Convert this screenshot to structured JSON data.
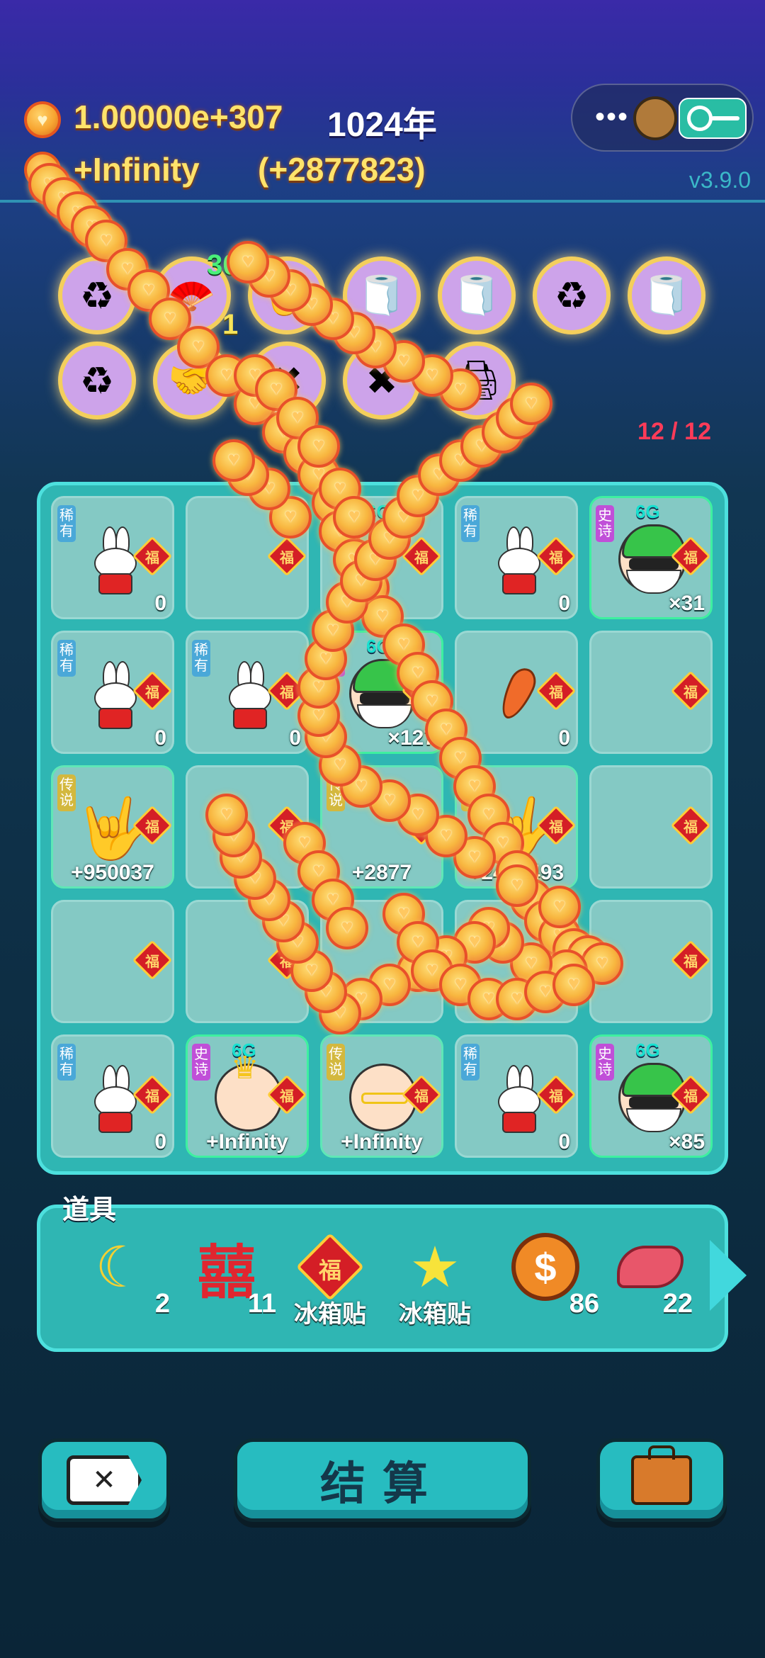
{
  "header": {
    "coins": "1.00000e+307",
    "year": "1024年",
    "rate": "+Infinity",
    "rate_detail": "(+2877823)",
    "version": "v3.9.0",
    "menu_icon": "more-dots-icon",
    "close_icon": "close-circle-icon"
  },
  "skills": {
    "row1": [
      {
        "icon": "recycle-icon",
        "count": ""
      },
      {
        "icon": "fan-icon",
        "count": "30"
      },
      {
        "icon": "rock-hand-icon",
        "count": ""
      },
      {
        "icon": "tissue-box-icon",
        "count": ""
      },
      {
        "icon": "tissue-box-icon",
        "count": ""
      },
      {
        "icon": "recycle-icon",
        "count": ""
      },
      {
        "icon": "tissue-box-icon",
        "count": ""
      }
    ],
    "row2": [
      {
        "icon": "recycle-icon",
        "count": ""
      },
      {
        "icon": "handshake-icon",
        "count": "1"
      },
      {
        "icon": "multiplier-icon",
        "count": ""
      },
      {
        "icon": "multiplier-icon",
        "count": ""
      },
      {
        "icon": "printer-icon",
        "count": ""
      }
    ],
    "row2_extra_count": "1",
    "slots": "12 / 12"
  },
  "board": {
    "cells": [
      {
        "tag": "稀有",
        "char": "rabbit",
        "count": "0"
      },
      {
        "tag": "",
        "char": "",
        "count": ""
      },
      {
        "tag": "",
        "char": "",
        "count": "",
        "lvl": "6G"
      },
      {
        "tag": "稀有",
        "char": "rabbit",
        "count": "0"
      },
      {
        "tag": "史诗",
        "char": "green-hat",
        "count": "×31",
        "lvl": "6G"
      },
      {
        "tag": "稀有",
        "char": "rabbit",
        "count": "0"
      },
      {
        "tag": "稀有",
        "char": "rabbit",
        "count": "0"
      },
      {
        "tag": "史诗",
        "char": "green-hat",
        "count": "×127",
        "lvl": "6G"
      },
      {
        "tag": "",
        "char": "carrot",
        "count": "0"
      },
      {
        "tag": "",
        "char": "",
        "count": ""
      },
      {
        "tag": "传说",
        "char": "rock-hand",
        "count": "+950037"
      },
      {
        "tag": "",
        "char": "",
        "count": ""
      },
      {
        "tag": "传说",
        "char": "",
        "count": "+2877"
      },
      {
        "tag": "传说",
        "char": "rock-hand",
        "count": "+2430493"
      },
      {
        "tag": "",
        "char": "",
        "count": ""
      },
      {
        "tag": "",
        "char": "",
        "count": ""
      },
      {
        "tag": "",
        "char": "",
        "count": ""
      },
      {
        "tag": "",
        "char": "",
        "count": ""
      },
      {
        "tag": "",
        "char": "",
        "count": ""
      },
      {
        "tag": "",
        "char": "",
        "count": ""
      },
      {
        "tag": "稀有",
        "char": "rabbit",
        "count": "0"
      },
      {
        "tag": "史诗",
        "char": "king",
        "count": "+Infinity",
        "lvl": "6G"
      },
      {
        "tag": "传说",
        "char": "bald",
        "count": "+Infinity"
      },
      {
        "tag": "稀有",
        "char": "rabbit",
        "count": "0"
      },
      {
        "tag": "史诗",
        "char": "green-hat",
        "count": "×85",
        "lvl": "6G"
      }
    ],
    "fu": "福"
  },
  "tools": {
    "label": "道具",
    "items": [
      {
        "icon": "moon-icon",
        "qty": "2",
        "name": ""
      },
      {
        "icon": "double-happiness-icon",
        "qty": "11",
        "name": ""
      },
      {
        "icon": "fu-sticker-icon",
        "qty": "",
        "name": "冰箱贴"
      },
      {
        "icon": "star-icon",
        "qty": "",
        "name": "冰箱贴"
      },
      {
        "icon": "dollar-coin-icon",
        "qty": "86",
        "name": ""
      },
      {
        "icon": "liver-icon",
        "qty": "22",
        "name": ""
      }
    ],
    "double_happiness": "囍",
    "dollar": "$"
  },
  "buttons": {
    "close_symbol": "✕",
    "settle": "结算",
    "bag_icon": "briefcase-icon"
  }
}
